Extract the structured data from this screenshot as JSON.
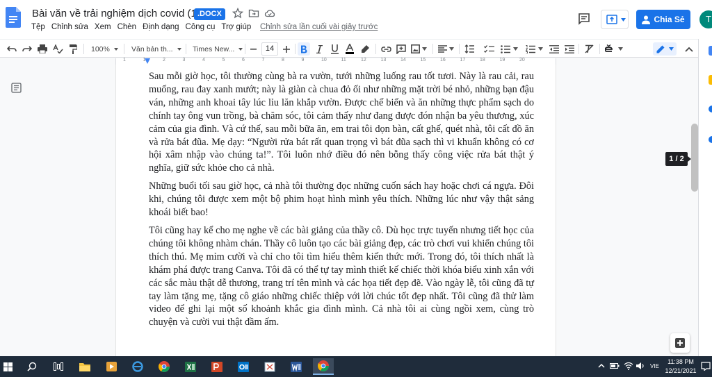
{
  "document": {
    "title": "Bài văn về trải nghiệm dịch covid (1)",
    "file_badge": ".DOCX",
    "last_edit": "Chỉnh sửa lần cuối vài giây trước"
  },
  "menu": [
    "Tệp",
    "Chỉnh sửa",
    "Xem",
    "Chèn",
    "Định dạng",
    "Công cụ",
    "Trợ giúp"
  ],
  "header": {
    "share_label": "Chia Sẻ",
    "avatar_initial": "T"
  },
  "toolbar": {
    "zoom": "100%",
    "style": "Văn bản th...",
    "font": "Times New...",
    "font_size": "14"
  },
  "ruler_numbers": [
    "1",
    "1",
    "2",
    "3",
    "4",
    "5",
    "6",
    "7",
    "8",
    "9",
    "10",
    "11",
    "12",
    "13",
    "14",
    "15",
    "16",
    "17",
    "18",
    "19",
    "20"
  ],
  "body": {
    "paragraphs": [
      "Sau mỗi giờ học, tôi thường cùng bà ra vườn, tưới những luống rau tốt tươi. Này là rau cải, rau muống, rau đay xanh mướt; này là giàn cà chua đỏ ối như những mặt trời bé nhỏ, những bạn đậu ván, những anh khoai tây lúc lỉu lăn khắp vườn. Được chế biến và ăn những thực phẩm sạch do chính tay  ông vun trồng, bà chăm sóc, tôi cảm thấy như đang được đón nhận ba yêu thương, xúc cảm của gia đình. Và cứ thế, sau mỗi bữa ăn, em trai tôi dọn bàn, cất ghế, quét nhà, tôi cất đồ ăn và rửa bát đũa. Mẹ dạy: “Người rửa bát rất quan trọng vì bát đũa sạch thì vi khuẩn không có cơ hội xâm nhập vào chúng ta!”. Tôi luôn nhớ điều đó nên bỗng thấy công việc rửa bát thật ý nghĩa, giữ sức khỏe cho cả nhà.",
      "Những buổi tối sau giờ học, cả nhà tôi thường đọc những cuốn sách hay hoặc chơi cá ngựa. Đôi khi, chúng tôi được xem một bộ phim hoạt hình mình yêu thích. Những lúc như vậy thật sảng khoái biết bao!",
      "Tôi cũng hay kể cho mẹ nghe về các bài giảng của thầy cô. Dù học trực tuyến nhưng tiết học của chúng tôi không nhàm chán. Thầy cô luôn tạo các bài giảng đẹp, các trò chơi vui khiến chúng tôi thích thú. Mẹ mỉm cười và chỉ cho tôi tìm hiểu thêm kiến thức mới. Trong đó, tôi thích nhất là khám phá được trang Canva. Tôi đã có thể tự tay mình thiết kế chiếc thời khóa biểu xinh xắn với các sắc màu thật dễ thương, trang trí tên mình và các họa tiết đẹp đẽ. Vào ngày lễ, tôi cũng đã tự tay làm tặng mẹ, tặng cô giáo những chiếc thiệp với lời chúc tốt đẹp nhất. Tôi cũng đã thử làm video để ghi lại một số khoảnh khắc gia đình mình. Cả nhà tôi ai cùng ngồi xem, cùng trò chuyện và cười vui thật đầm ấm."
    ]
  },
  "page_indicator": "1 / 2",
  "taskbar": {
    "language": "VIE",
    "time": "11:38 PM",
    "date": "12/21/2021"
  },
  "colors": {
    "accent": "#1a73e8",
    "avatar": "#00897b",
    "taskbar": "#1f2c3b"
  }
}
